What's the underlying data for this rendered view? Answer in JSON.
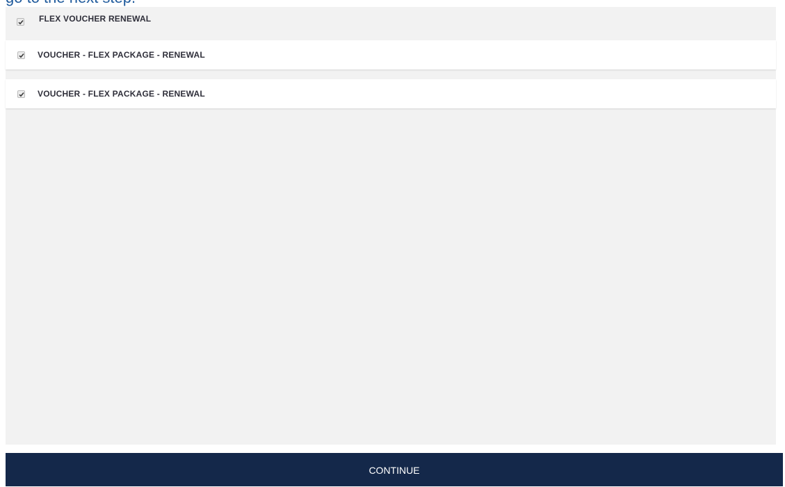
{
  "heading": {
    "text": "go to the next step."
  },
  "packages": {
    "parent": {
      "label": "FLEX VOUCHER RENEWAL",
      "checked": true
    },
    "items": [
      {
        "label": "VOUCHER - FLEX PACKAGE - RENEWAL",
        "checked": true
      },
      {
        "label": "VOUCHER - FLEX PACKAGE - RENEWAL",
        "checked": true
      }
    ]
  },
  "footer": {
    "continue_label": "CONTINUE"
  },
  "colors": {
    "heading": "#1f5a9c",
    "panel_background": "#f2f2f2",
    "button_background": "#14284a",
    "button_text": "#ffffff"
  },
  "icons": {
    "checkbox": "checkmark-icon"
  }
}
